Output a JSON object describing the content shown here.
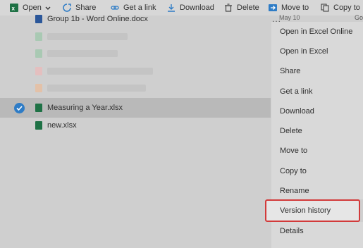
{
  "toolbar": {
    "open_label": "Open",
    "share_label": "Share",
    "get_link_label": "Get a link",
    "download_label": "Download",
    "delete_label": "Delete",
    "move_to_label": "Move to",
    "copy_to_label": "Copy to"
  },
  "files": {
    "partial_top": "Group 1b - Word Online.docx",
    "selected": "Measuring a Year.xlsx",
    "next": "new.xlsx"
  },
  "date_partial": "May 10",
  "ellipsis": "...",
  "right_edge_partial": "Go",
  "context_menu": {
    "items": [
      "Open in Excel Online",
      "Open in Excel",
      "Share",
      "Get a link",
      "Download",
      "Delete",
      "Move to",
      "Copy to",
      "Rename",
      "Version history",
      "Details"
    ]
  },
  "colors": {
    "excel_green": "#1e7145",
    "word_blue": "#2b579a",
    "accent_blue": "#2e7cc6",
    "highlight_red": "#d23a3a"
  }
}
